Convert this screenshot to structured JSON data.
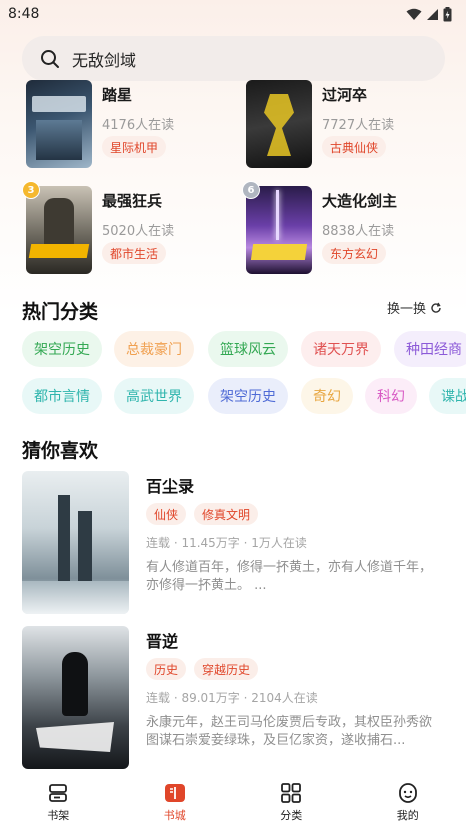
{
  "status": {
    "time": "8:48"
  },
  "search": {
    "query": "无敌剑域"
  },
  "ranking": [
    {
      "rank": "",
      "title": "踏星",
      "readers": "4176人在读",
      "tag": "星际机甲"
    },
    {
      "rank": "",
      "title": "过河卒",
      "readers": "7727人在读",
      "tag": "古典仙侠"
    },
    {
      "rank": "3",
      "title": "最强狂兵",
      "readers": "5020人在读",
      "tag": "都市生活"
    },
    {
      "rank": "6",
      "title": "大造化剑主",
      "readers": "8838人在读",
      "tag": "东方玄幻"
    }
  ],
  "hot_categories": {
    "title": "热门分类",
    "refresh_label": "换一换",
    "row1": [
      "架空历史",
      "总裁豪门",
      "篮球风云",
      "诸天万界",
      "种田经商"
    ],
    "row2": [
      "都市言情",
      "高武世界",
      "架空历史",
      "奇幻",
      "科幻",
      "谍战"
    ]
  },
  "guess": {
    "title": "猜你喜欢",
    "books": [
      {
        "title": "百尘录",
        "tags": [
          "仙侠",
          "修真文明"
        ],
        "meta": "连载 · 11.45万字 · 1万人在读",
        "desc": "有人修道百年，修得一抔黄土，亦有人修道千年，亦修得一抔黄土。 ..."
      },
      {
        "title": "晋逆",
        "tags": [
          "历史",
          "穿越历史"
        ],
        "meta": "连载 · 89.01万字 · 2104人在读",
        "desc": "永康元年，赵王司马伦废贾后专政，其权臣孙秀欲图谋石崇爱妾绿珠，及巨亿家资，遂收捕石..."
      }
    ]
  },
  "tabs": [
    {
      "label": "书架",
      "icon": "bookshelf-icon"
    },
    {
      "label": "书城",
      "icon": "bookstore-icon"
    },
    {
      "label": "分类",
      "icon": "category-icon"
    },
    {
      "label": "我的",
      "icon": "profile-icon"
    }
  ],
  "colors": {
    "accent": "#e0462a",
    "tag_bg": "#fbeee9"
  }
}
